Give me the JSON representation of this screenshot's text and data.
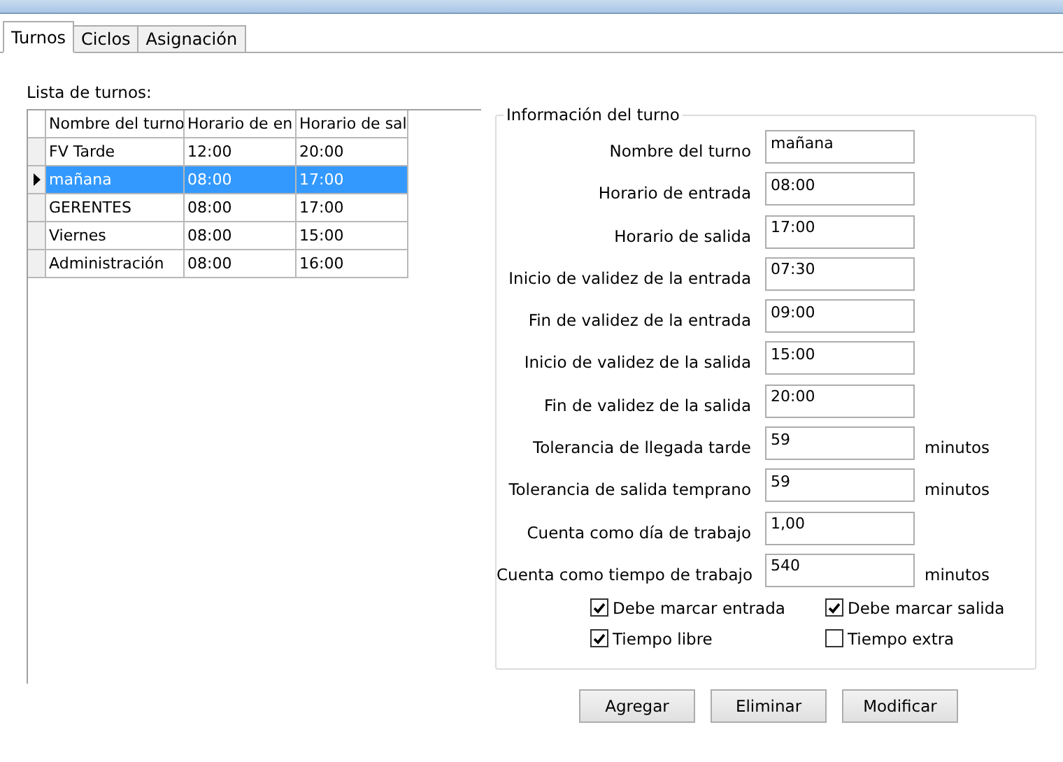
{
  "tabs": [
    {
      "label": "Turnos",
      "selected": true
    },
    {
      "label": "Ciclos",
      "selected": false
    },
    {
      "label": "Asignación",
      "selected": false
    }
  ],
  "shift_list": {
    "label": "Lista de turnos:",
    "columns": [
      "Nombre del turno",
      "Horario de en",
      "Horario de sal"
    ],
    "rows": [
      {
        "cells": [
          "FV Tarde",
          "12:00",
          "20:00"
        ],
        "selected": false
      },
      {
        "cells": [
          "mañana",
          "08:00",
          "17:00"
        ],
        "selected": true
      },
      {
        "cells": [
          "GERENTES",
          "08:00",
          "17:00"
        ],
        "selected": false
      },
      {
        "cells": [
          "Viernes",
          "08:00",
          "15:00"
        ],
        "selected": false
      },
      {
        "cells": [
          "Administración",
          "08:00",
          "16:00"
        ],
        "selected": false
      }
    ]
  },
  "shift_info": {
    "title": "Información del turno",
    "fields": [
      {
        "label": "Nombre del turno",
        "value": "mañana"
      },
      {
        "label": "Horario de entrada",
        "value": "08:00"
      },
      {
        "label": "Horario de salida",
        "value": "17:00"
      },
      {
        "label": "Inicio de validez de la entrada",
        "value": "07:30"
      },
      {
        "label": "Fin de validez de la entrada",
        "value": "09:00"
      },
      {
        "label": "Inicio de validez de la salida",
        "value": "15:00"
      },
      {
        "label": "Fin de validez de la salida",
        "value": "20:00"
      },
      {
        "label": "Tolerancia de llegada tarde",
        "value": "59",
        "unit": "minutos"
      },
      {
        "label": "Tolerancia de salida temprano",
        "value": "59",
        "unit": "minutos"
      },
      {
        "label": "Cuenta como día de trabajo",
        "value": "1,00"
      },
      {
        "label": "Cuenta como tiempo de trabajo",
        "value": "540",
        "unit": "minutos"
      }
    ],
    "checkboxes": [
      {
        "label": "Debe marcar entrada",
        "checked": true
      },
      {
        "label": "Debe marcar salida",
        "checked": true
      },
      {
        "label": "Tiempo libre",
        "checked": true
      },
      {
        "label": "Tiempo extra",
        "checked": false
      }
    ]
  },
  "buttons": [
    "Agregar",
    "Eliminar",
    "Modificar"
  ]
}
